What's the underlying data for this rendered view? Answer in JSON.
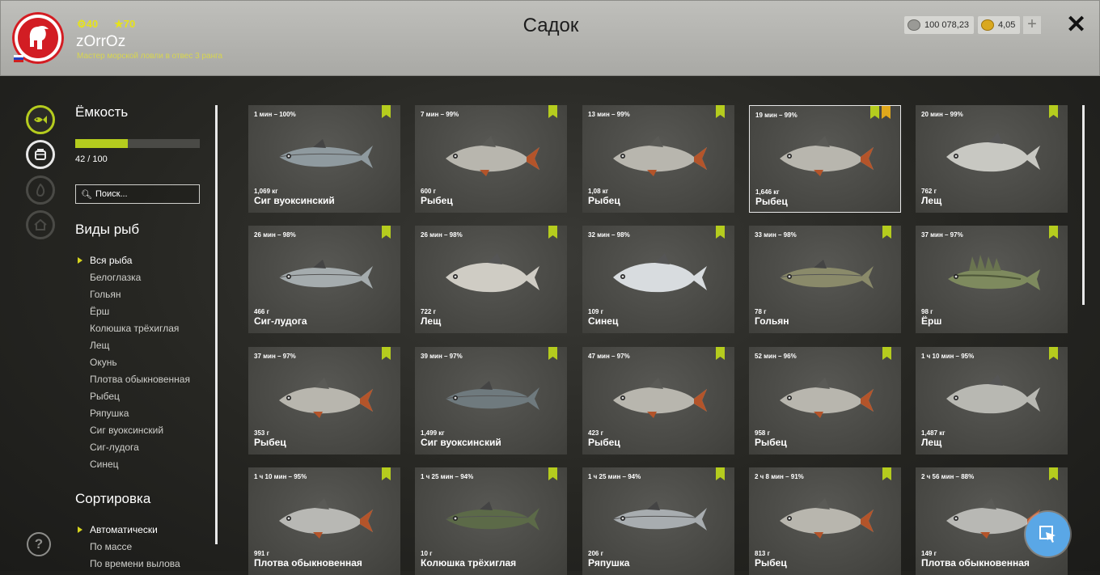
{
  "header": {
    "title": "Садок",
    "username": "zOrrOz",
    "level": "40",
    "rank_stars": "70",
    "rank_title": "Мастер морской ловли в отвес 3 ранга",
    "silver": "100 078,23",
    "gold": "4,05",
    "plus_label": "+",
    "close_label": "✕"
  },
  "sidebar_icons": [
    "keepnet-icon",
    "backpack-icon",
    "fire-icon",
    "home-icon"
  ],
  "left_panel": {
    "capacity_title": "Ёмкость",
    "capacity_count": "42 / 100",
    "capacity_fraction": 0.42,
    "search_placeholder": "Поиск...",
    "species_title": "Виды рыб",
    "species": [
      "Вся рыба",
      "Белоглазка",
      "Гольян",
      "Ёрш",
      "Колюшка трёхиглая",
      "Лещ",
      "Окунь",
      "Плотва обыкновенная",
      "Рыбец",
      "Ряпушка",
      "Сиг вуоксинский",
      "Сиг-лудога",
      "Синец"
    ],
    "sort_title": "Сортировка",
    "sort_options": [
      "Автоматически",
      "По массе",
      "По времени вылова"
    ]
  },
  "fish_cards": [
    {
      "time": "1 мин – 100%",
      "weight": "1,069 кг",
      "name": "Сиг вуоксинский",
      "color": "#8f9a9f",
      "shape": "slim"
    },
    {
      "time": "7 мин – 99%",
      "weight": "600 г",
      "name": "Рыбец",
      "color": "#b8b6ae",
      "shape": "deep"
    },
    {
      "time": "13 мин – 99%",
      "weight": "1,08 кг",
      "name": "Рыбец",
      "color": "#b8b6ae",
      "shape": "deep"
    },
    {
      "time": "19 мин – 99%",
      "weight": "1,646 кг",
      "name": "Рыбец",
      "color": "#b8b6ae",
      "shape": "deep",
      "favorite": true,
      "selected": true
    },
    {
      "time": "20 мин – 99%",
      "weight": "762 г",
      "name": "Лещ",
      "color": "#c8c8c2",
      "shape": "bream"
    },
    {
      "time": "26 мин – 98%",
      "weight": "466 г",
      "name": "Сиг-лудога",
      "color": "#a5acae",
      "shape": "slim"
    },
    {
      "time": "26 мин – 98%",
      "weight": "722 г",
      "name": "Лещ",
      "color": "#cfccc4",
      "shape": "bream"
    },
    {
      "time": "32 мин – 98%",
      "weight": "109 г",
      "name": "Синец",
      "color": "#d8dcdf",
      "shape": "bream"
    },
    {
      "time": "33 мин – 98%",
      "weight": "78 г",
      "name": "Гольян",
      "color": "#8a8a6a",
      "shape": "slim"
    },
    {
      "time": "37 мин – 97%",
      "weight": "98 г",
      "name": "Ёрш",
      "color": "#7e8a5e",
      "shape": "ruffe"
    },
    {
      "time": "37 мин – 97%",
      "weight": "353 г",
      "name": "Рыбец",
      "color": "#b8b6ae",
      "shape": "deep"
    },
    {
      "time": "39 мин – 97%",
      "weight": "1,499 кг",
      "name": "Сиг вуоксинский",
      "color": "#6f7a7e",
      "shape": "slim"
    },
    {
      "time": "47 мин – 97%",
      "weight": "423 г",
      "name": "Рыбец",
      "color": "#b8b6ae",
      "shape": "deep"
    },
    {
      "time": "52 мин – 96%",
      "weight": "958 г",
      "name": "Рыбец",
      "color": "#b8b6ae",
      "shape": "deep"
    },
    {
      "time": "1 ч 10 мин – 95%",
      "weight": "1,487 кг",
      "name": "Лещ",
      "color": "#b8b8b2",
      "shape": "bream"
    },
    {
      "time": "1 ч 10 мин – 95%",
      "weight": "991 г",
      "name": "Плотва обыкновенная",
      "color": "#b8b8b4",
      "shape": "deep"
    },
    {
      "time": "1 ч 25 мин – 94%",
      "weight": "10 г",
      "name": "Колюшка трёхиглая",
      "color": "#5c6a48",
      "shape": "slim"
    },
    {
      "time": "1 ч 25 мин – 94%",
      "weight": "206 г",
      "name": "Ряпушка",
      "color": "#a8adb0",
      "shape": "slim"
    },
    {
      "time": "2 ч 8 мин – 91%",
      "weight": "813 г",
      "name": "Рыбец",
      "color": "#b8b6ae",
      "shape": "deep"
    },
    {
      "time": "2 ч 56 мин – 88%",
      "weight": "149 г",
      "name": "Плотва обыкновенная",
      "color": "#b8b8b4",
      "shape": "deep"
    }
  ]
}
